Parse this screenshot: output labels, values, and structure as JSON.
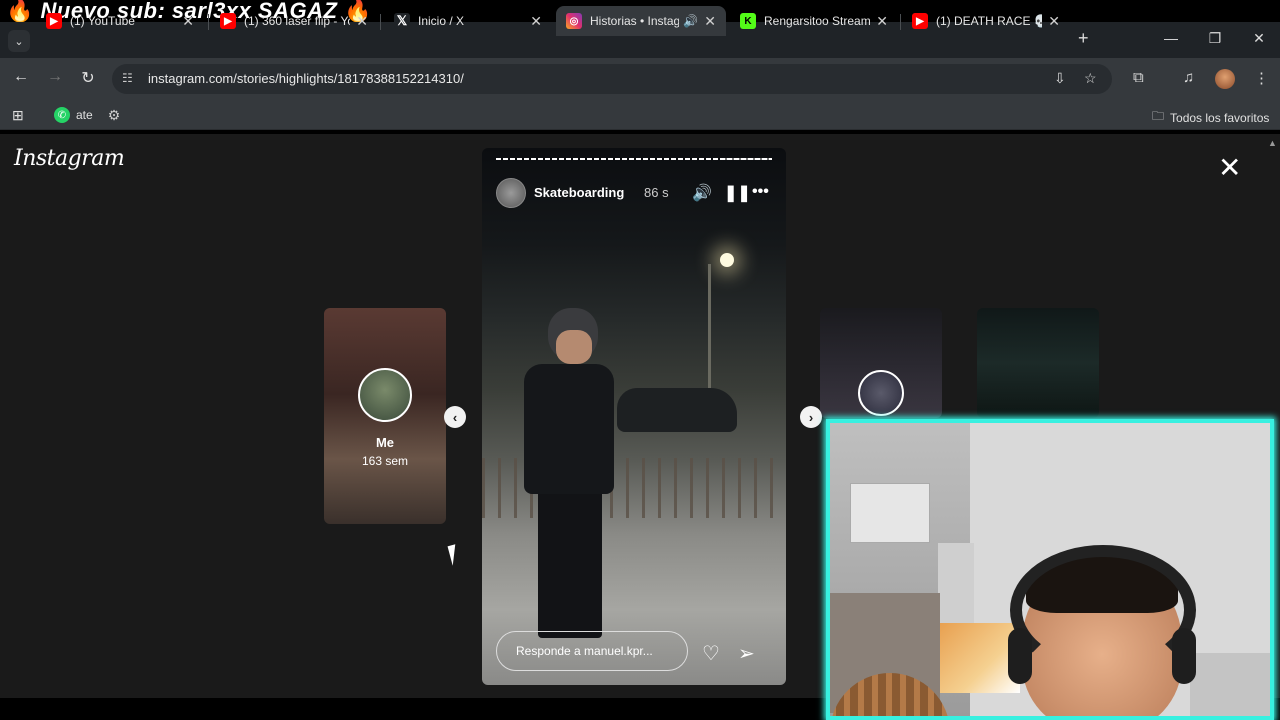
{
  "overlay": {
    "banner_text": "Nuevo sub: sarl3xx SAGAZ",
    "fire_icon": "🔥"
  },
  "browser": {
    "tabs": [
      {
        "title": "(1) YouTube",
        "favicon": "youtube-icon",
        "color": "#ff0000",
        "active": false
      },
      {
        "title": "(1) 360 laser flip - You",
        "favicon": "youtube-icon",
        "color": "#ff0000",
        "active": false
      },
      {
        "title": "Inicio / X",
        "favicon": "x-icon",
        "color": "#000000",
        "active": false
      },
      {
        "title": "Historias • Instag",
        "favicon": "instagram-icon",
        "color": "#e1306c",
        "active": true
      },
      {
        "title": "Rengarsitoo Stream -",
        "favicon": "kick-icon",
        "color": "#53fc18",
        "active": false
      },
      {
        "title": "(1) DEATH RACE 💀",
        "favicon": "youtube-icon",
        "color": "#ff0000",
        "active": false
      }
    ],
    "url": "instagram.com/stories/highlights/18178388152214310/",
    "bookmarks": [
      {
        "label": "ate",
        "icon": "whatsapp-icon"
      }
    ],
    "bookmarks_right": "Todos los favoritos"
  },
  "page": {
    "logo": "Instagram",
    "left_story": {
      "name": "Me",
      "age": "163 sem"
    },
    "story": {
      "username": "Skateboarding",
      "time": "86 s",
      "reply_placeholder": "Responde a manuel.kpr..."
    }
  }
}
